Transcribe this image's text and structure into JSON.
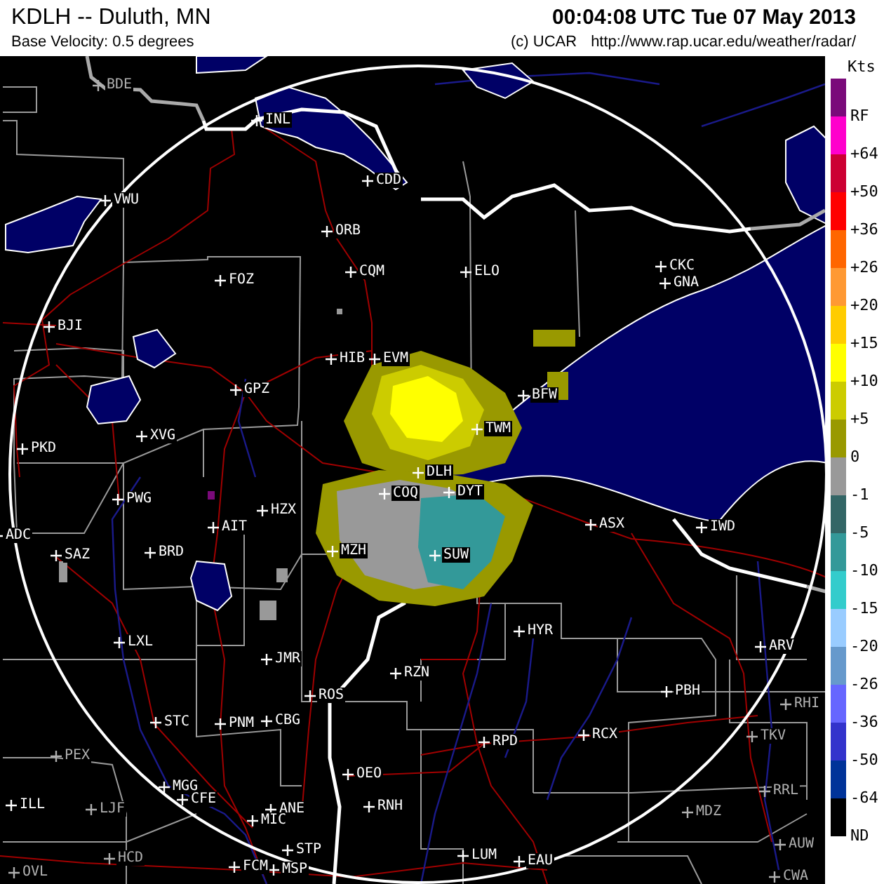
{
  "header": {
    "title": "KDLH -- Duluth, MN",
    "subtitle": "Base Velocity: 0.5 degrees",
    "timestamp": "00:04:08 UTC Tue 07 May 2013",
    "credit": "(c) UCAR",
    "url": "http://www.rap.ucar.edu/weather/radar/"
  },
  "legend": {
    "unit": "Kts",
    "items": [
      {
        "label": "RF",
        "color": "#7a0a7a"
      },
      {
        "label": "+64",
        "color": "#ff00cc"
      },
      {
        "label": "+50",
        "color": "#cc0033"
      },
      {
        "label": "+36",
        "color": "#ff0000"
      },
      {
        "label": "+26",
        "color": "#ff6600"
      },
      {
        "label": "+20",
        "color": "#ff9933"
      },
      {
        "label": "+15",
        "color": "#ffcc00"
      },
      {
        "label": "+10",
        "color": "#ffff00"
      },
      {
        "label": "+5",
        "color": "#cccc00"
      },
      {
        "label": "0",
        "color": "#999900"
      },
      {
        "label": "-1",
        "color": "#999999"
      },
      {
        "label": "-5",
        "color": "#336666"
      },
      {
        "label": "-10",
        "color": "#339999"
      },
      {
        "label": "-15",
        "color": "#33cccc"
      },
      {
        "label": "-20",
        "color": "#99ccff"
      },
      {
        "label": "-26",
        "color": "#6699cc"
      },
      {
        "label": "-36",
        "color": "#6666ff"
      },
      {
        "label": "-50",
        "color": "#3333cc"
      },
      {
        "label": "-64",
        "color": "#003399"
      },
      {
        "label": "ND",
        "color": "#000000"
      }
    ]
  },
  "map": {
    "stations": [
      {
        "label": "BDE",
        "dimmed": true
      },
      {
        "label": "INL",
        "dimmed": false
      },
      {
        "label": "CDD",
        "dimmed": false
      },
      {
        "label": "VWU",
        "dimmed": false
      },
      {
        "label": "ORB",
        "dimmed": false
      },
      {
        "label": "CQM",
        "dimmed": false
      },
      {
        "label": "FOZ",
        "dimmed": false
      },
      {
        "label": "ELO",
        "dimmed": false
      },
      {
        "label": "CKC",
        "dimmed": false
      },
      {
        "label": "GNA",
        "dimmed": false
      },
      {
        "label": "BJI",
        "dimmed": false
      },
      {
        "label": "HIB",
        "dimmed": false
      },
      {
        "label": "EVM",
        "dimmed": false
      },
      {
        "label": "GPZ",
        "dimmed": false
      },
      {
        "label": "BFW",
        "dimmed": false
      },
      {
        "label": "XVG",
        "dimmed": false
      },
      {
        "label": "PKD",
        "dimmed": false
      },
      {
        "label": "TWM",
        "dimmed": false
      },
      {
        "label": "DLH",
        "dimmed": false
      },
      {
        "label": "COQ",
        "dimmed": false
      },
      {
        "label": "DYT",
        "dimmed": false
      },
      {
        "label": "PWG",
        "dimmed": false
      },
      {
        "label": "HZX",
        "dimmed": false
      },
      {
        "label": "AIT",
        "dimmed": false
      },
      {
        "label": "ADC",
        "dimmed": false
      },
      {
        "label": "SAZ",
        "dimmed": false
      },
      {
        "label": "BRD",
        "dimmed": false
      },
      {
        "label": "MZH",
        "dimmed": false
      },
      {
        "label": "SUW",
        "dimmed": false
      },
      {
        "label": "ASX",
        "dimmed": false
      },
      {
        "label": "IWD",
        "dimmed": false
      },
      {
        "label": "LXL",
        "dimmed": false
      },
      {
        "label": "JMR",
        "dimmed": false
      },
      {
        "label": "HYR",
        "dimmed": false
      },
      {
        "label": "ARV",
        "dimmed": false
      },
      {
        "label": "RZN",
        "dimmed": false
      },
      {
        "label": "ROS",
        "dimmed": false
      },
      {
        "label": "PBH",
        "dimmed": false
      },
      {
        "label": "RHI",
        "dimmed": true
      },
      {
        "label": "STC",
        "dimmed": false
      },
      {
        "label": "PNM",
        "dimmed": false
      },
      {
        "label": "CBG",
        "dimmed": false
      },
      {
        "label": "RPD",
        "dimmed": false
      },
      {
        "label": "RCX",
        "dimmed": false
      },
      {
        "label": "TKV",
        "dimmed": true
      },
      {
        "label": "PEX",
        "dimmed": true
      },
      {
        "label": "OEO",
        "dimmed": false
      },
      {
        "label": "MGG",
        "dimmed": false
      },
      {
        "label": "CFE",
        "dimmed": false
      },
      {
        "label": "RRL",
        "dimmed": true
      },
      {
        "label": "ILL",
        "dimmed": false
      },
      {
        "label": "LJF",
        "dimmed": true
      },
      {
        "label": "ANE",
        "dimmed": false
      },
      {
        "label": "RNH",
        "dimmed": false
      },
      {
        "label": "MIC",
        "dimmed": false
      },
      {
        "label": "MDZ",
        "dimmed": true
      },
      {
        "label": "AUW",
        "dimmed": true
      },
      {
        "label": "HCD",
        "dimmed": true
      },
      {
        "label": "STP",
        "dimmed": false
      },
      {
        "label": "MSP",
        "dimmed": false
      },
      {
        "label": "LUM",
        "dimmed": false
      },
      {
        "label": "EAU",
        "dimmed": false
      },
      {
        "label": "FCM",
        "dimmed": false
      },
      {
        "label": "OVL",
        "dimmed": true
      },
      {
        "label": "CWA",
        "dimmed": true
      }
    ]
  }
}
